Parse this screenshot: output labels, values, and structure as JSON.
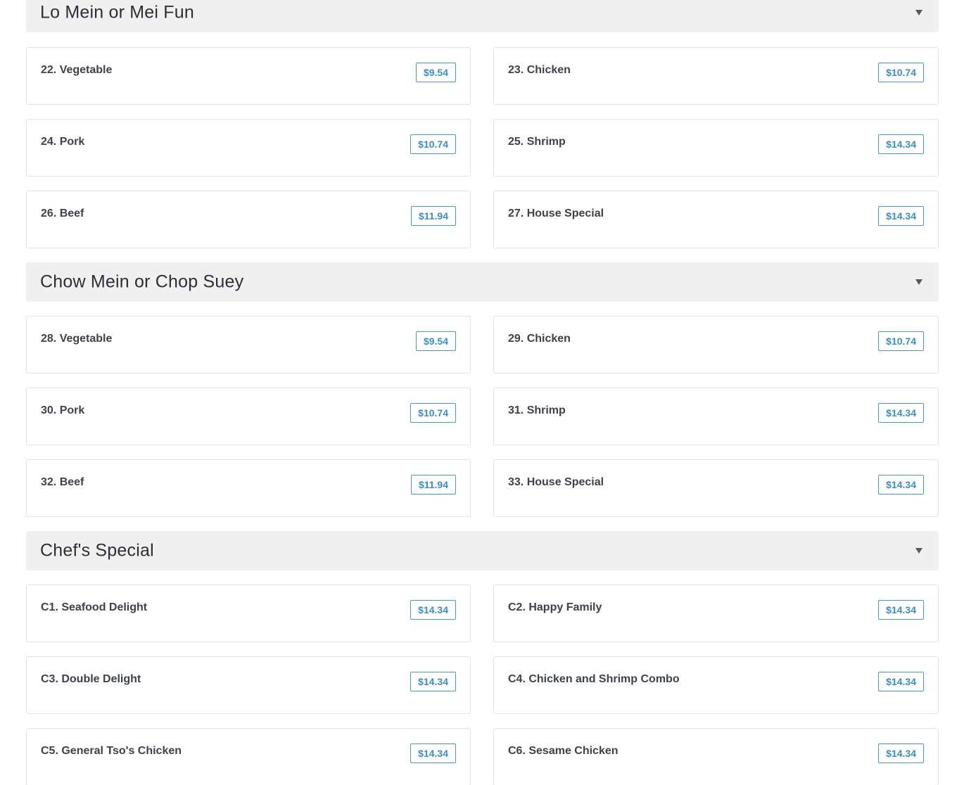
{
  "sections": [
    {
      "title": "Lo Mein or Mei Fun",
      "items": [
        {
          "name": "22. Vegetable",
          "price": "$9.54"
        },
        {
          "name": "23. Chicken",
          "price": "$10.74"
        },
        {
          "name": "24. Pork",
          "price": "$10.74"
        },
        {
          "name": "25. Shrimp",
          "price": "$14.34"
        },
        {
          "name": "26. Beef",
          "price": "$11.94"
        },
        {
          "name": "27. House Special",
          "price": "$14.34"
        }
      ]
    },
    {
      "title": "Chow Mein or Chop Suey",
      "items": [
        {
          "name": "28. Vegetable",
          "price": "$9.54"
        },
        {
          "name": "29. Chicken",
          "price": "$10.74"
        },
        {
          "name": "30. Pork",
          "price": "$10.74"
        },
        {
          "name": "31. Shrimp",
          "price": "$14.34"
        },
        {
          "name": "32. Beef",
          "price": "$11.94"
        },
        {
          "name": "33. House Special",
          "price": "$14.34"
        }
      ]
    },
    {
      "title": "Chef's Special",
      "items": [
        {
          "name": "C1. Seafood Delight",
          "price": "$14.34"
        },
        {
          "name": "C2. Happy Family",
          "price": "$14.34"
        },
        {
          "name": "C3. Double Delight",
          "price": "$14.34"
        },
        {
          "name": "C4. Chicken and Shrimp Combo",
          "price": "$14.34"
        },
        {
          "name": "C5. General Tso's Chicken",
          "price": "$14.34"
        },
        {
          "name": "C6. Sesame Chicken",
          "price": "$14.34"
        }
      ]
    }
  ],
  "icons": {
    "section_toggle": "chevron-down-icon"
  },
  "colors": {
    "price_accent": "#3a8fc2",
    "section_header_bg": "#f0f0f0",
    "card_border": "#e3e4e6"
  }
}
